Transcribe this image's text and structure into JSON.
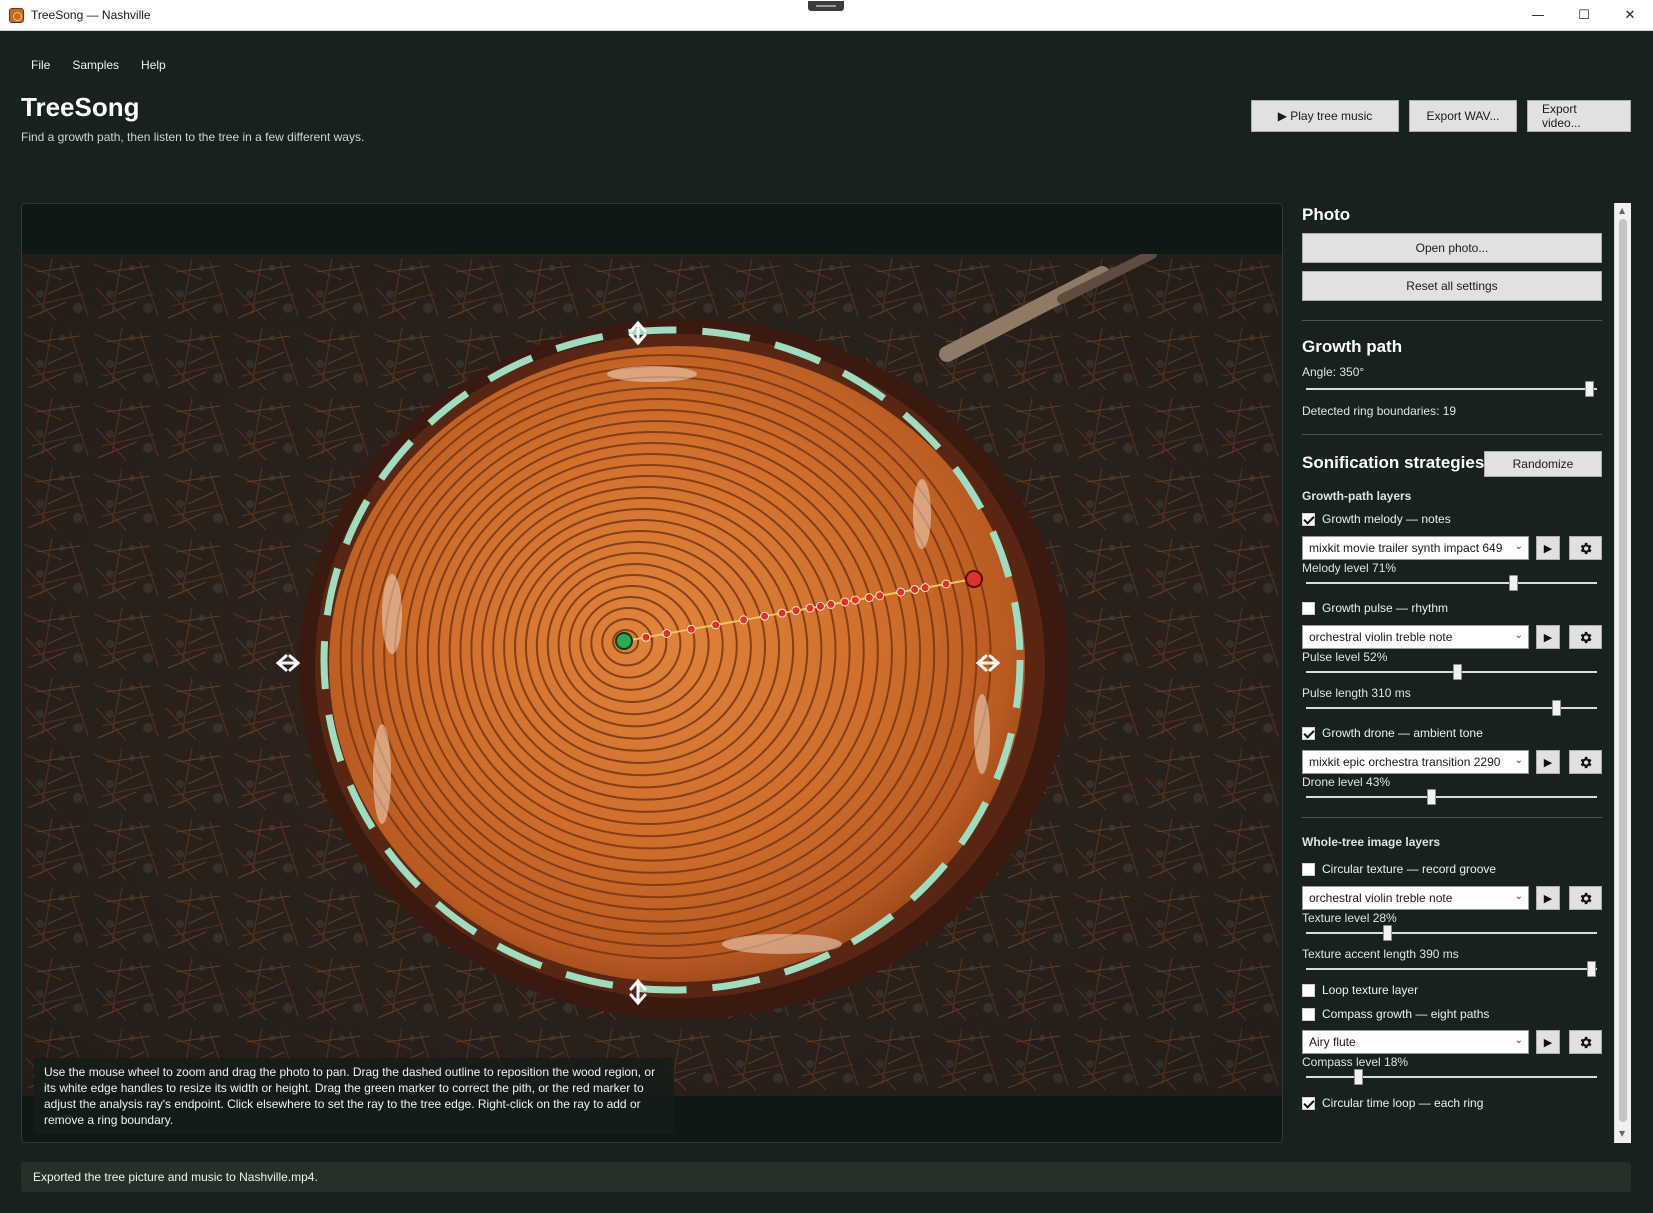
{
  "window": {
    "title": "TreeSong — Nashville"
  },
  "menu": [
    "File",
    "Samples",
    "Help"
  ],
  "app": {
    "title": "TreeSong",
    "subtitle": "Find a growth path, then listen to the tree in a few different ways."
  },
  "toolbar": {
    "play_label": "▶ Play tree music",
    "export_wav_label": "Export WAV...",
    "export_video_label": "Export video..."
  },
  "photo_panel": {
    "help_text": "Use the mouse wheel to zoom and drag the photo to pan. Drag the dashed outline to reposition the wood region, or its white edge handles to resize its width or height. Drag the green marker to correct the pith, or the red marker to adjust the analysis ray's endpoint. Click elsewhere to set the ray to the tree edge. Right-click on the ray to add or remove a ring boundary."
  },
  "sidebar": {
    "photo": {
      "title": "Photo",
      "open_label": "Open photo...",
      "reset_label": "Reset all settings"
    },
    "growth_path": {
      "title": "Growth path",
      "angle_label": "Angle: 350°",
      "angle_fraction": 0.972,
      "boundaries_label": "Detected ring boundaries: 19"
    },
    "sonification": {
      "title": "Sonification strategies",
      "randomize_label": "Randomize",
      "growth_layers_title": "Growth-path layers",
      "melody": {
        "label": "Growth melody — notes",
        "checked": true,
        "sample": "mixkit movie trailer synth impact 649",
        "level_label": "Melody level  71%",
        "level": 0.71
      },
      "pulse": {
        "label": "Growth pulse — rhythm",
        "checked": false,
        "sample": "orchestral violin treble note",
        "level_label": "Pulse level  52%",
        "level": 0.52,
        "length_label": "Pulse length  310 ms",
        "length_fraction": 0.86
      },
      "drone": {
        "label": "Growth drone — ambient tone",
        "checked": true,
        "sample": "mixkit epic orchestra transition 2290",
        "level_label": "Drone level  43%",
        "level": 0.43
      },
      "whole_tree_title": "Whole-tree image layers",
      "texture": {
        "label": "Circular texture — record groove",
        "checked": false,
        "sample": "orchestral violin treble note",
        "level_label": "Texture level  28%",
        "level": 0.28,
        "accent_label": "Texture accent length  390 ms",
        "accent_fraction": 0.98
      },
      "loop_texture": {
        "label": "Loop texture layer",
        "checked": false
      },
      "compass": {
        "label": "Compass growth — eight paths",
        "checked": false,
        "sample": "Airy flute",
        "level_label": "Compass level  18%",
        "level": 0.18
      },
      "time_loop": {
        "label": "Circular time loop — each ring",
        "checked": true
      }
    }
  },
  "status": {
    "text": "Exported the tree picture and music to Nashville.mp4."
  },
  "colors": {
    "accent_ring": "#9fdcc0",
    "pith_marker": "#2fa84f",
    "end_marker": "#e0322c",
    "ray": "#f1c65a"
  }
}
